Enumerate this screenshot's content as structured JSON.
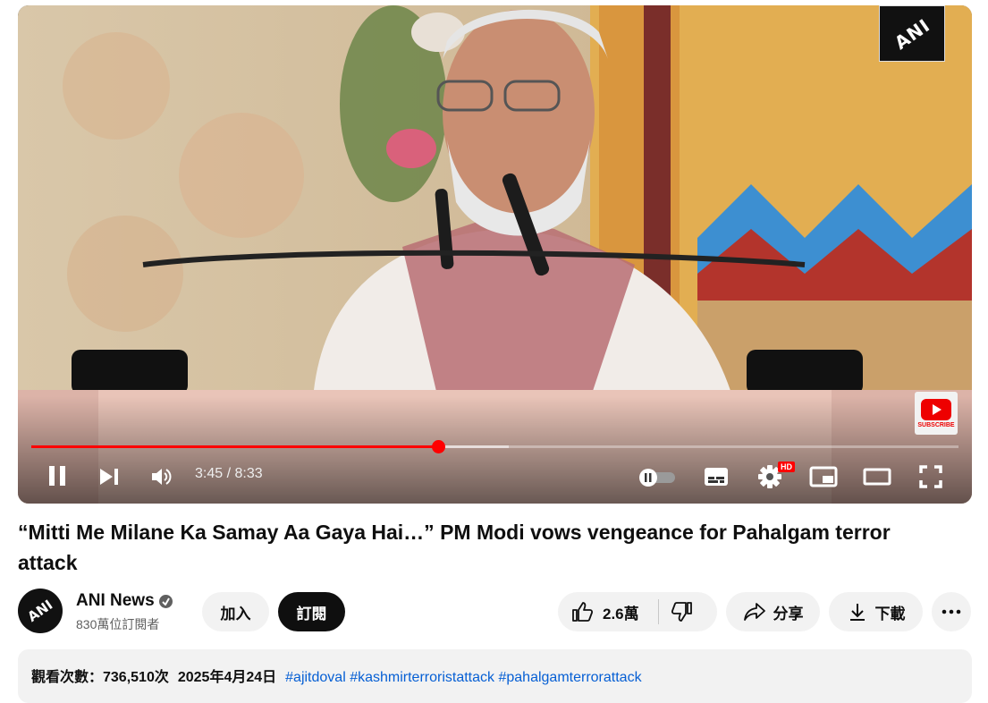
{
  "player": {
    "current_time": "3:45",
    "duration": "8:33",
    "time_display": "3:45 / 8:33",
    "progress_fraction": 0.4385,
    "buffered_fraction": 0.515,
    "settings_badge": "HD",
    "watermark_text": "ANI",
    "subscribe_badge_text": "SUBSCRIBE",
    "accent_color": "#ff0000"
  },
  "video": {
    "title": "“Mitti Me Milane Ka Samay Aa Gaya Hai…” PM Modi vows vengeance for Pahalgam terror attack"
  },
  "channel": {
    "name": "ANI News",
    "subscribers": "830萬位訂閱者",
    "avatar_text": "ANI",
    "join_label": "加入",
    "subscribe_label": "訂閱"
  },
  "actions": {
    "like_count": "2.6萬",
    "share_label": "分享",
    "download_label": "下載"
  },
  "description": {
    "views": "觀看次數：736,510次",
    "date": "2025年4月24日",
    "hashtags": [
      "#ajitdoval",
      "#kashmirterroristattack",
      "#pahalgamterrorattack"
    ]
  },
  "icons": {
    "pause": "pause-icon",
    "next": "next-icon",
    "volume": "volume-icon",
    "autoplay": "autoplay-toggle-icon",
    "captions": "captions-icon",
    "settings": "gear-icon",
    "miniplayer": "miniplayer-icon",
    "theater": "theater-icon",
    "fullscreen": "fullscreen-icon",
    "like": "thumb-up-icon",
    "dislike": "thumb-down-icon",
    "share": "share-icon",
    "download": "download-icon",
    "more": "more-horizontal-icon"
  }
}
